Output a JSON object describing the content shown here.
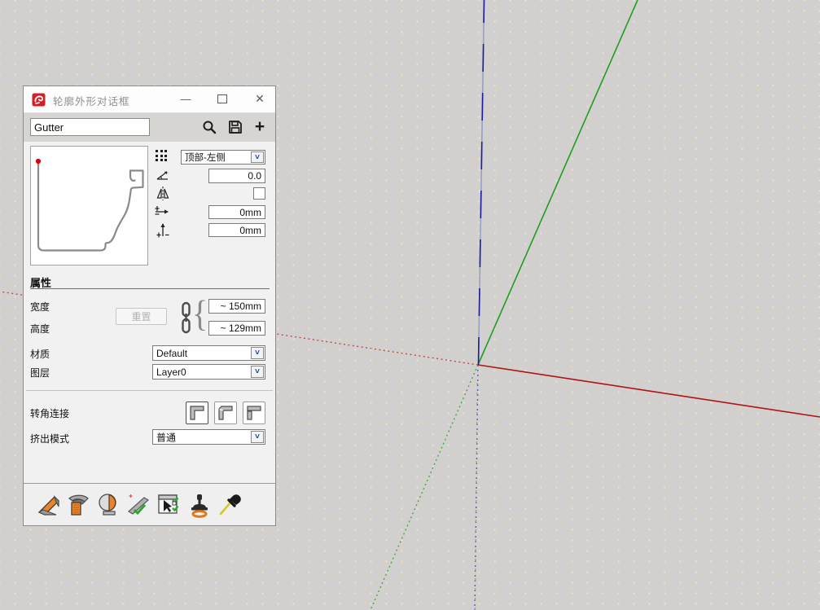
{
  "window": {
    "title": "轮廓外形对话框"
  },
  "glyphs": {
    "minimize": "—",
    "close": "✕",
    "chevron": "˅",
    "plus": "+",
    "brace": "{"
  },
  "search": {
    "value": "Gutter"
  },
  "profile": {
    "name_in_search": "Gutter"
  },
  "placement": {
    "anchor_value": "顶部-左侧",
    "rotation_value": "0.0",
    "flip_checked": false,
    "offset_x_value": "0mm",
    "offset_y_value": "0mm"
  },
  "properties": {
    "header": "属性",
    "width_label": "宽度",
    "height_label": "高度",
    "reset_label": "重置",
    "width_value": "~ 150mm",
    "height_value": "~ 129mm",
    "material_label": "材质",
    "material_value": "Default",
    "layer_label": "图层",
    "layer_value": "Layer0"
  },
  "corner": {
    "label": "转角连接",
    "options": [
      "welded-corner",
      "mitered-corner",
      "butt-joint-corner"
    ],
    "selected_index": 0
  },
  "extrude": {
    "label": "挤出模式",
    "value": "普通"
  },
  "toolbar_icons": [
    "search-icon",
    "save-icon",
    "add-profile-icon"
  ],
  "tool_icons": [
    "sweep-solid-icon",
    "follow-path-icon",
    "revolve-icon",
    "validate-profile-icon",
    "apply-to-selection-icon",
    "stamp-icon",
    "eyedropper-icon"
  ],
  "colors": {
    "axis_red": "#b01414",
    "axis_green": "#1f9e1f",
    "axis_blue": "#1c1c9e",
    "accent_red": "#cf1d1d",
    "profile_stroke": "#8a8a8a",
    "viewport_bg": "#d1d0ce"
  }
}
